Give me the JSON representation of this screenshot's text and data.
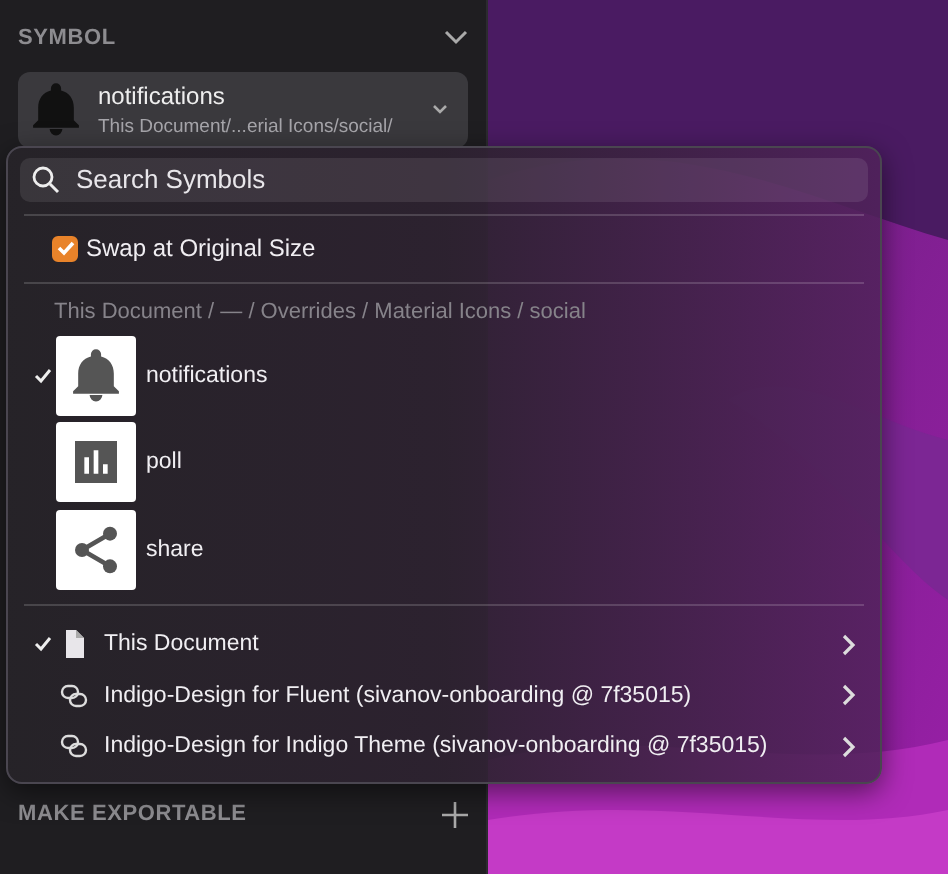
{
  "sidebar": {
    "section_title": "SYMBOL",
    "symbol_picker": {
      "name": "notifications",
      "path": "This Document/...erial Icons/social/",
      "kind": "bell"
    },
    "footer_section": "MAKE EXPORTABLE"
  },
  "popup": {
    "search": {
      "placeholder": "Search Symbols"
    },
    "swap_option": {
      "label": "Swap at Original Size",
      "checked": true
    },
    "path": "This Document / — / Overrides / Material Icons / social",
    "symbols": [
      {
        "name": "notifications",
        "kind": "bell",
        "selected": true
      },
      {
        "name": "poll",
        "kind": "poll",
        "selected": false
      },
      {
        "name": "share",
        "kind": "share",
        "selected": false
      }
    ],
    "libraries": [
      {
        "name": "This Document",
        "kind": "document",
        "selected": true
      },
      {
        "name": "Indigo-Design for Fluent (sivanov-onboarding @ 7f35015)",
        "kind": "linked",
        "selected": false
      },
      {
        "name": "Indigo-Design for Indigo Theme (sivanov-onboarding @ 7f35015)",
        "kind": "linked",
        "selected": false
      }
    ]
  }
}
